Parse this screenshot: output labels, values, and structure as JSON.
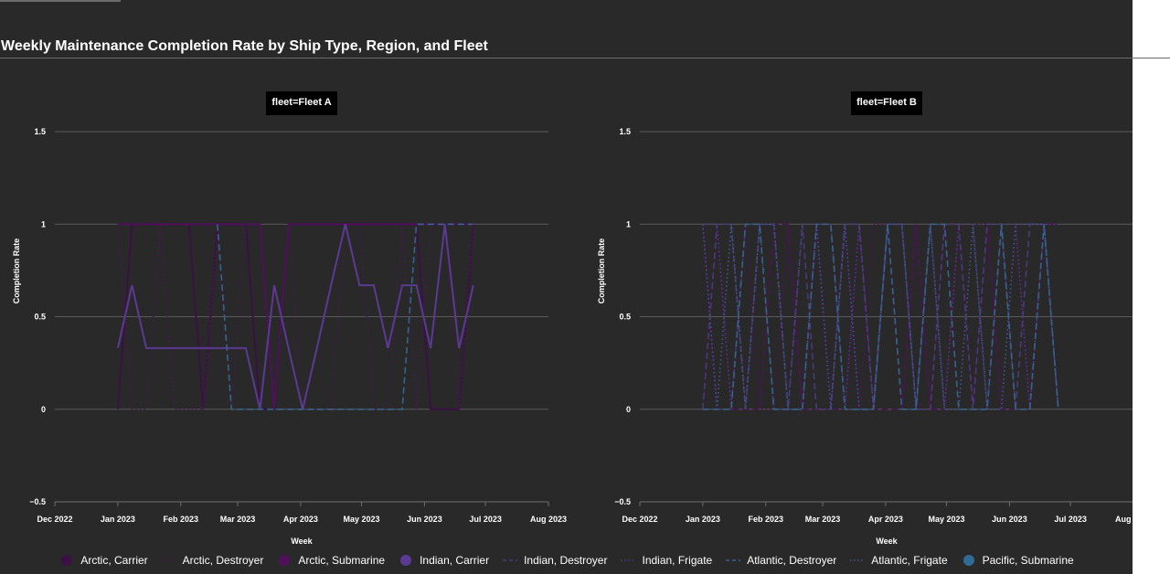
{
  "page_title": "Weekly Maintenance Completion Rate by Ship Type, Region, and Fleet",
  "chart_data": {
    "type": "line",
    "title": "Weekly Maintenance Completion Rate by Ship Type, Region, and Fleet",
    "xlabel": "Week",
    "ylabel": "Completion Rate",
    "ylim": [
      -0.5,
      1.5
    ],
    "y_ticks": [
      1.5,
      1,
      0.5,
      0,
      -0.5
    ],
    "y_tick_labels": [
      "1.5",
      "1",
      "0.5",
      "0",
      "−0.5"
    ],
    "x_ticks": [
      "2022-12-01",
      "2023-01-01",
      "2023-02-01",
      "2023-03-01",
      "2023-04-01",
      "2023-05-01",
      "2023-06-01",
      "2023-07-01",
      "2023-08-01"
    ],
    "x_tick_labels": [
      "Dec 2022",
      "Jan 2023",
      "Feb 2023",
      "Mar 2023",
      "Apr 2023",
      "May 2023",
      "Jun 2023",
      "Jul 2023",
      "Aug 2023"
    ],
    "grid": true,
    "legend_position": "bottom",
    "panels": [
      {
        "title": "fleet=Fleet A",
        "series": [
          {
            "name": "Arctic, Carrier",
            "color": "#3b1145",
            "dash": "solid",
            "x": [
              "2023-01-01",
              "2023-01-08",
              "2023-01-15",
              "2023-01-22",
              "2023-01-29",
              "2023-02-05",
              "2023-02-12",
              "2023-02-19",
              "2023-02-26",
              "2023-03-05",
              "2023-03-12",
              "2023-03-19",
              "2023-03-26",
              "2023-04-02",
              "2023-04-09",
              "2023-04-16",
              "2023-04-23",
              "2023-04-30",
              "2023-05-07",
              "2023-05-14",
              "2023-05-21",
              "2023-05-28",
              "2023-06-04",
              "2023-06-11",
              "2023-06-18",
              "2023-06-25"
            ],
            "y": [
              0,
              1,
              1,
              1,
              1,
              1,
              0,
              1,
              1,
              1,
              0,
              0,
              1,
              1,
              1,
              1,
              1,
              1,
              1,
              1,
              1,
              1,
              0,
              0,
              0,
              1
            ]
          },
          {
            "name": "Arctic, Destroyer",
            "color": "#4a1656",
            "dash": "dot",
            "x": [
              "2023-01-01",
              "2023-01-08",
              "2023-01-15",
              "2023-01-22",
              "2023-01-29",
              "2023-02-05",
              "2023-02-12",
              "2023-02-19",
              "2023-02-26",
              "2023-03-05",
              "2023-03-12",
              "2023-03-19",
              "2023-03-26",
              "2023-04-02",
              "2023-04-09",
              "2023-04-16",
              "2023-04-23",
              "2023-04-30",
              "2023-05-07",
              "2023-05-14",
              "2023-05-21",
              "2023-05-28",
              "2023-06-04",
              "2023-06-11",
              "2023-06-18",
              "2023-06-25"
            ],
            "y": [
              1,
              0,
              0,
              1,
              0,
              0,
              0,
              1,
              0,
              1,
              1,
              0,
              1,
              0,
              0,
              0,
              1,
              1,
              0,
              0,
              1,
              0,
              1,
              1,
              0,
              1
            ]
          },
          {
            "name": "Arctic, Submarine",
            "color": "#50105c",
            "dash": "solid",
            "x": [
              "2023-01-01",
              "2023-01-08",
              "2023-01-15",
              "2023-01-22",
              "2023-01-29",
              "2023-02-05",
              "2023-02-12",
              "2023-02-19",
              "2023-02-26",
              "2023-03-05",
              "2023-03-12",
              "2023-03-19",
              "2023-03-26",
              "2023-04-02",
              "2023-04-09",
              "2023-04-16",
              "2023-04-23",
              "2023-04-30",
              "2023-05-07",
              "2023-05-14",
              "2023-05-21",
              "2023-05-28",
              "2023-06-04",
              "2023-06-11",
              "2023-06-18",
              "2023-06-25"
            ],
            "y": [
              1,
              1,
              1,
              1,
              1,
              1,
              1,
              1,
              1,
              1,
              1,
              0,
              1,
              1,
              1,
              1,
              1,
              1,
              1,
              1,
              1,
              1,
              1,
              1,
              1,
              1
            ]
          },
          {
            "name": "Indian, Carrier",
            "color": "#5b3a94",
            "dash": "solid",
            "x": [
              "2023-01-01",
              "2023-01-08",
              "2023-01-15",
              "2023-01-22",
              "2023-01-29",
              "2023-02-05",
              "2023-02-12",
              "2023-02-19",
              "2023-02-26",
              "2023-03-05",
              "2023-03-12",
              "2023-03-19",
              "2023-03-26",
              "2023-04-02",
              "2023-04-09",
              "2023-04-16",
              "2023-04-23",
              "2023-04-30",
              "2023-05-07",
              "2023-05-14",
              "2023-05-21",
              "2023-05-28",
              "2023-06-04",
              "2023-06-11",
              "2023-06-18",
              "2023-06-25"
            ],
            "y": [
              0.33,
              0.67,
              0.33,
              0.33,
              0.33,
              0.33,
              0.33,
              0.33,
              0.33,
              0.33,
              0,
              0.67,
              0.33,
              0,
              0.33,
              0.67,
              1,
              0.67,
              0.67,
              0.33,
              0.67,
              0.67,
              0.33,
              1,
              0.33,
              0.67
            ]
          },
          {
            "name": "Indian, Destroyer",
            "color": "#4a3a7a",
            "dash": "dash",
            "x": [],
            "y": []
          },
          {
            "name": "Indian, Frigate",
            "color": "#4b3f86",
            "dash": "dot",
            "x": [],
            "y": []
          },
          {
            "name": "Atlantic, Destroyer",
            "color": "#36648f",
            "dash": "dash",
            "x": [
              "2023-02-19",
              "2023-02-26",
              "2023-03-05",
              "2023-03-12",
              "2023-03-19",
              "2023-03-26",
              "2023-04-02",
              "2023-04-09",
              "2023-04-16",
              "2023-04-23",
              "2023-04-30",
              "2023-05-07",
              "2023-05-14",
              "2023-05-21",
              "2023-05-28",
              "2023-06-04",
              "2023-06-11",
              "2023-06-18",
              "2023-06-25"
            ],
            "y": [
              1,
              0,
              0,
              0,
              0,
              0,
              0,
              0,
              0,
              0,
              0,
              0,
              0,
              0,
              1,
              1,
              1,
              1,
              1
            ]
          },
          {
            "name": "Atlantic, Frigate",
            "color": "#3e5a94",
            "dash": "dot",
            "x": [],
            "y": []
          },
          {
            "name": "Pacific, Submarine",
            "color": "#2f6b96",
            "dash": "solid",
            "x": [],
            "y": []
          }
        ]
      },
      {
        "title": "fleet=Fleet B",
        "series": [
          {
            "name": "Arctic, Carrier",
            "color": "#3b1145",
            "dash": "solid",
            "x": [],
            "y": []
          },
          {
            "name": "Arctic, Destroyer",
            "color": "#4a1656",
            "dash": "dash",
            "x": [
              "2023-01-01",
              "2023-01-08",
              "2023-01-15",
              "2023-01-22",
              "2023-01-29",
              "2023-02-05",
              "2023-02-12",
              "2023-02-19",
              "2023-02-26",
              "2023-03-05",
              "2023-03-12",
              "2023-03-19",
              "2023-03-26",
              "2023-04-02",
              "2023-04-09",
              "2023-04-16",
              "2023-04-23",
              "2023-04-30",
              "2023-05-07",
              "2023-05-14",
              "2023-05-21",
              "2023-05-28",
              "2023-06-04",
              "2023-06-11",
              "2023-06-18",
              "2023-06-25"
            ],
            "y": [
              1,
              0,
              0,
              0,
              0,
              1,
              1,
              0,
              0,
              0,
              0,
              1,
              0,
              0,
              0,
              1,
              0,
              0,
              1,
              0,
              1,
              0,
              0,
              0,
              1,
              1
            ]
          },
          {
            "name": "Arctic, Submarine",
            "color": "#50105c",
            "dash": "dot",
            "x": [
              "2023-01-01",
              "2023-01-08",
              "2023-01-15",
              "2023-01-22",
              "2023-01-29",
              "2023-02-05",
              "2023-02-12",
              "2023-02-19",
              "2023-02-26",
              "2023-03-05",
              "2023-03-12",
              "2023-03-19",
              "2023-03-26",
              "2023-04-02",
              "2023-04-09",
              "2023-04-16",
              "2023-04-23",
              "2023-04-30",
              "2023-05-07",
              "2023-05-14",
              "2023-05-21",
              "2023-05-28",
              "2023-06-04",
              "2023-06-11",
              "2023-06-18",
              "2023-06-25"
            ],
            "y": [
              0,
              1,
              0,
              1,
              0,
              0,
              1,
              0,
              1,
              0,
              1,
              0,
              1,
              1,
              0,
              1,
              0,
              1,
              0,
              1,
              1,
              0,
              1,
              0,
              1,
              1
            ]
          },
          {
            "name": "Indian, Carrier",
            "color": "#5b3a94",
            "dash": "solid",
            "x": [],
            "y": []
          },
          {
            "name": "Indian, Destroyer",
            "color": "#4a3a7a",
            "dash": "dash",
            "x": [
              "2023-01-01",
              "2023-01-08",
              "2023-01-15",
              "2023-01-22",
              "2023-01-29",
              "2023-02-05",
              "2023-02-12",
              "2023-02-19",
              "2023-02-26",
              "2023-03-05",
              "2023-03-12",
              "2023-03-19",
              "2023-03-26",
              "2023-04-02",
              "2023-04-09",
              "2023-04-16",
              "2023-04-23",
              "2023-04-30",
              "2023-05-07",
              "2023-05-14",
              "2023-05-21",
              "2023-05-28",
              "2023-06-04",
              "2023-06-11",
              "2023-06-18",
              "2023-06-25"
            ],
            "y": [
              0,
              1,
              1,
              0,
              1,
              1,
              0,
              1,
              0,
              0,
              1,
              1,
              0,
              1,
              1,
              0,
              0,
              1,
              1,
              0,
              1,
              1,
              0,
              1,
              1,
              0
            ]
          },
          {
            "name": "Indian, Frigate",
            "color": "#4b3f86",
            "dash": "dot",
            "x": [
              "2023-01-01",
              "2023-01-08",
              "2023-01-15",
              "2023-01-22",
              "2023-01-29",
              "2023-02-05",
              "2023-02-12",
              "2023-02-19",
              "2023-02-26",
              "2023-03-05",
              "2023-03-12",
              "2023-03-19",
              "2023-03-26",
              "2023-04-02",
              "2023-04-09",
              "2023-04-16",
              "2023-04-23",
              "2023-04-30",
              "2023-05-07",
              "2023-05-14",
              "2023-05-21",
              "2023-05-28",
              "2023-06-04",
              "2023-06-11",
              "2023-06-18",
              "2023-06-25"
            ],
            "y": [
              1,
              1,
              0,
              1,
              1,
              0,
              0,
              1,
              1,
              1,
              0,
              1,
              0,
              1,
              1,
              0,
              1,
              0,
              1,
              1,
              0,
              1,
              1,
              0,
              1,
              1
            ]
          },
          {
            "name": "Atlantic, Destroyer",
            "color": "#36648f",
            "dash": "dash",
            "x": [
              "2023-01-01",
              "2023-01-08",
              "2023-01-15",
              "2023-01-22",
              "2023-01-29",
              "2023-02-05",
              "2023-02-12",
              "2023-02-19",
              "2023-02-26",
              "2023-03-05",
              "2023-03-12",
              "2023-03-19",
              "2023-03-26",
              "2023-04-02",
              "2023-04-09",
              "2023-04-16",
              "2023-04-23",
              "2023-04-30",
              "2023-05-07",
              "2023-05-14",
              "2023-05-21",
              "2023-05-28",
              "2023-06-04",
              "2023-06-11",
              "2023-06-18",
              "2023-06-25"
            ],
            "y": [
              0,
              0,
              0,
              1,
              1,
              0,
              0,
              0,
              1,
              1,
              0,
              0,
              0,
              1,
              0,
              0,
              1,
              1,
              0,
              0,
              0,
              1,
              0,
              0,
              1,
              0
            ]
          },
          {
            "name": "Atlantic, Frigate",
            "color": "#3e5a94",
            "dash": "dot",
            "x": [
              "2023-01-01",
              "2023-01-08",
              "2023-01-15",
              "2023-01-22",
              "2023-01-29",
              "2023-02-05",
              "2023-02-12",
              "2023-02-19",
              "2023-02-26",
              "2023-03-05",
              "2023-03-12",
              "2023-03-19",
              "2023-03-26",
              "2023-04-02",
              "2023-04-09",
              "2023-04-16",
              "2023-04-23",
              "2023-04-30",
              "2023-05-07",
              "2023-05-14",
              "2023-05-21",
              "2023-05-28",
              "2023-06-04",
              "2023-06-11",
              "2023-06-18",
              "2023-06-25"
            ],
            "y": [
              1,
              0,
              1,
              0,
              1,
              1,
              0,
              0,
              1,
              0,
              1,
              0,
              0,
              1,
              1,
              0,
              1,
              0,
              0,
              1,
              0,
              0,
              1,
              1,
              1,
              0
            ]
          },
          {
            "name": "Pacific, Submarine",
            "color": "#2f6b96",
            "dash": "solid",
            "x": [],
            "y": []
          }
        ]
      }
    ]
  },
  "legend": [
    {
      "label": "Arctic, Carrier",
      "marker": "circle",
      "color": "#3b1145"
    },
    {
      "label": "Arctic, Destroyer",
      "marker": "dot",
      "color": "#4a1656"
    },
    {
      "label": "Arctic, Submarine",
      "marker": "circle",
      "color": "#50105c"
    },
    {
      "label": "Indian, Carrier",
      "marker": "circle",
      "color": "#5b3a94"
    },
    {
      "label": "Indian, Destroyer",
      "marker": "dash",
      "color": "#4a3a7a"
    },
    {
      "label": "Indian, Frigate",
      "marker": "dot",
      "color": "#4b3f86"
    },
    {
      "label": "Atlantic, Destroyer",
      "marker": "dash",
      "color": "#36648f"
    },
    {
      "label": "Atlantic, Frigate",
      "marker": "dot",
      "color": "#3e5a94"
    },
    {
      "label": "Pacific, Submarine",
      "marker": "circle",
      "color": "#2f6b96"
    }
  ]
}
